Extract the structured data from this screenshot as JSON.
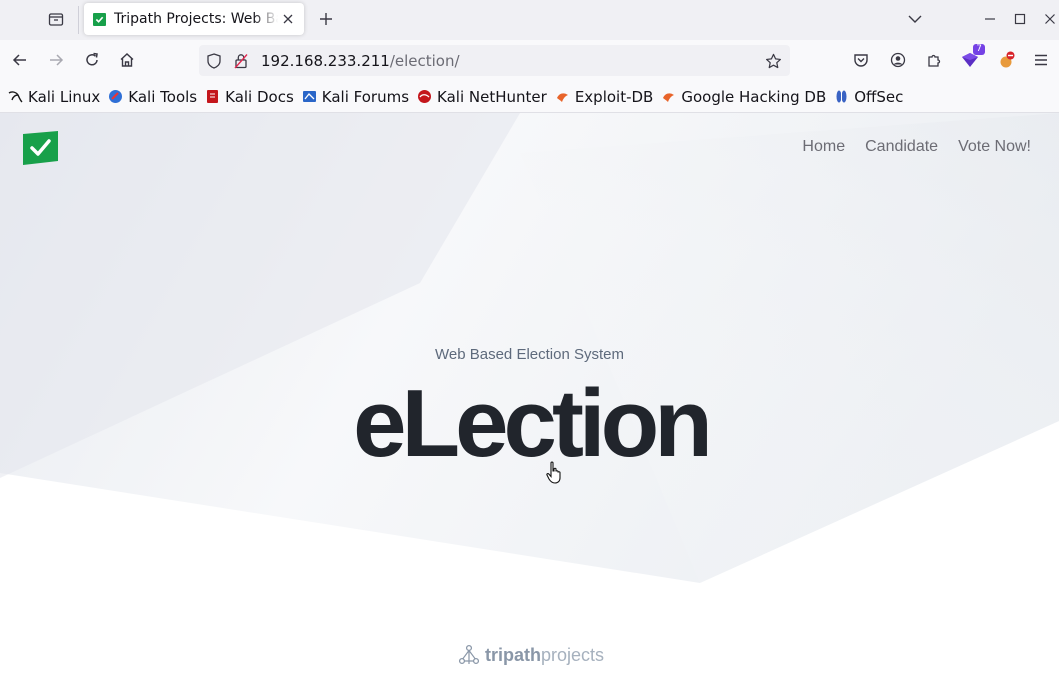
{
  "browser": {
    "tab": {
      "title": "Tripath Projects: Web Based Election System"
    },
    "url": {
      "host": "192.168.233.211",
      "path": "/election/"
    },
    "extension_badge": "7",
    "bookmarks": [
      {
        "label": "Kali Linux",
        "icon": "kali-dragon-icon"
      },
      {
        "label": "Kali Tools",
        "icon": "kali-tools-icon"
      },
      {
        "label": "Kali Docs",
        "icon": "kali-docs-icon"
      },
      {
        "label": "Kali Forums",
        "icon": "kali-forums-icon"
      },
      {
        "label": "Kali NetHunter",
        "icon": "nethunter-icon"
      },
      {
        "label": "Exploit-DB",
        "icon": "exploit-db-icon"
      },
      {
        "label": "Google Hacking DB",
        "icon": "ghdb-icon"
      },
      {
        "label": "OffSec",
        "icon": "offsec-icon"
      }
    ]
  },
  "site": {
    "nav": [
      "Home",
      "Candidate",
      "Vote Now!"
    ],
    "hero_subtitle": "Web Based Election System",
    "hero_title": "eLection",
    "footer_brand_a": "tripath",
    "footer_brand_b": "projects",
    "brand_color": "#18a04a"
  }
}
